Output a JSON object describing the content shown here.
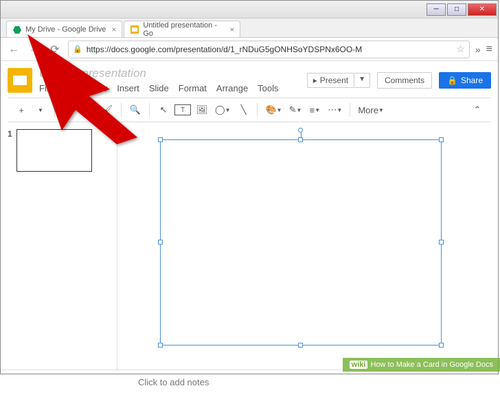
{
  "window": {
    "tabs": [
      {
        "title": "My Drive - Google Drive"
      },
      {
        "title": "Untitled presentation - Go"
      }
    ]
  },
  "addressbar": {
    "url": "https://docs.google.com/presentation/d/1_rNDuG5gONHSoYDSPNx6OO-M"
  },
  "doc": {
    "title": "Untitled presentation",
    "menus": {
      "file": "File",
      "edit": "Edit",
      "view": "View",
      "insert": "Insert",
      "slide": "Slide",
      "format": "Format",
      "arrange": "Arrange",
      "tools": "Tools"
    },
    "present": "Present",
    "comments": "Comments",
    "share": "Share"
  },
  "toolbar": {
    "more": "More"
  },
  "thumb": {
    "num": "1"
  },
  "notes": {
    "placeholder": "Click to add notes"
  },
  "footer": {
    "wiki": "wiki",
    "text": "How to Make a Card in Google Docs"
  }
}
